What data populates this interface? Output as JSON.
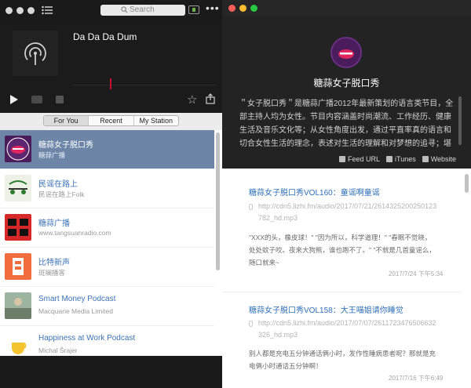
{
  "toolbar": {
    "search_placeholder": "Search",
    "more_label": "•••"
  },
  "now_playing": {
    "title": "Da Da Da Dum",
    "star": "☆"
  },
  "tabs": [
    "For You",
    "Recent",
    "My Station"
  ],
  "podcast_list": [
    {
      "title": "糖蒜女子脱口秀",
      "subtitle": "糖蒜广播",
      "icon": "mouth-logo-icon",
      "selected": true
    },
    {
      "title": "民谣在路上",
      "subtitle": "民谣在路上Folk",
      "icon": "folk-logo-icon",
      "selected": false
    },
    {
      "title": "糖蒜广播",
      "subtitle": "www.tangsuanradio.com",
      "icon": "tangsuan-logo-icon",
      "selected": false
    },
    {
      "title": "比特新声",
      "subtitle": "斑斓播客",
      "icon": "bitsound-logo-icon",
      "selected": false
    },
    {
      "title": "Smart Money Podcast",
      "subtitle": "Macquarie Media Limited",
      "icon": "smart-money-icon",
      "selected": false
    },
    {
      "title": "Happiness at Work Podcast",
      "subtitle": "Michal Šrajer",
      "icon": "happiness-icon",
      "selected": false
    }
  ],
  "detail": {
    "title": "糖蒜女子脱口秀",
    "description": "＂女子脱口秀＂是糖蒜广播2012年最新策划的语言类节目，全部主持人均为女性。节目内容涵盖时尚潮流、工作经历、健康生活及音乐文化等；从女性角度出发，通过平直率真的语言和切合女性生活的理念，表述对生活的理解和对梦想的追寻；堪称新时代不可多得的精品节目。",
    "links": [
      {
        "label": "Feed URL",
        "icon": "rss-icon"
      },
      {
        "label": "iTunes",
        "icon": "itunes-icon"
      },
      {
        "label": "Website",
        "icon": "website-icon"
      }
    ]
  },
  "episodes": [
    {
      "title": "糖蒜女子脱口秀VOL160：童谣啊童谣",
      "url": "http://cdn5.lizhi.fm/audio/2017/07/21/2614325200250123782_hd.mp3",
      "summary": "\"XXX的头，橡皮球！\" \"因为所以，科学道理！\" \"春眠不觉晓，处处蚊子咬。夜来大狗熊，谁也跑不了。\" \"不就是几首童谣么，随口就来~",
      "date": "2017/7/24 下午5:34"
    },
    {
      "title": "糖蒜女子脱口秀VOL158：大王喵姐请你睡觉",
      "url": "http://cdn5.lizhi.fm/audio/2017/07/07/2611723476506632326_hd.mp3",
      "summary": "别人都是充电五分钟通话俩小时，发作性睡病患者呢？那就是充电俩小时通话五分钟啊！",
      "date": "2017/7/16 下午6:49"
    }
  ],
  "colors": {
    "accent_link": "#2f6fb7",
    "selected_row": "#6d86a8",
    "close": "#ff5f57",
    "minimize": "#febc2e",
    "zoom": "#28c840"
  }
}
